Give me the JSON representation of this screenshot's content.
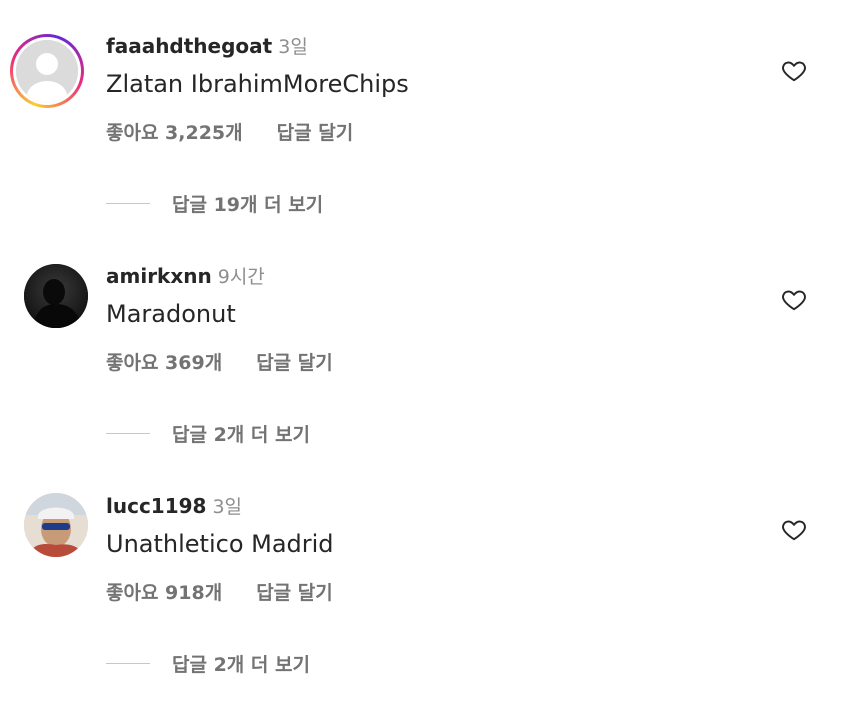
{
  "comments": [
    {
      "username": "faaahdthegoat",
      "time": "3일",
      "text": "Zlatan IbrahimMoreChips",
      "likes": "좋아요 3,225개",
      "reply_label": "답글 달기",
      "view_replies": "답글 19개 더 보기",
      "avatar": "default-avatar-with-story-ring"
    },
    {
      "username": "amirkxnn",
      "time": "9시간",
      "text": "Maradonut",
      "likes": "좋아요 369개",
      "reply_label": "답글 달기",
      "view_replies": "답글 2개 더 보기",
      "avatar": "dark-photo-avatar"
    },
    {
      "username": "lucc1198",
      "time": "3일",
      "text": "Unathletico Madrid",
      "likes": "좋아요 918개",
      "reply_label": "답글 달기",
      "view_replies": "답글 2개 더 보기",
      "avatar": "selfie-photo-avatar"
    }
  ],
  "icons": {
    "like": "heart-outline-icon"
  },
  "colors": {
    "text_primary": "#262626",
    "text_secondary": "#737373",
    "story_ring": "#ee2a7b"
  }
}
